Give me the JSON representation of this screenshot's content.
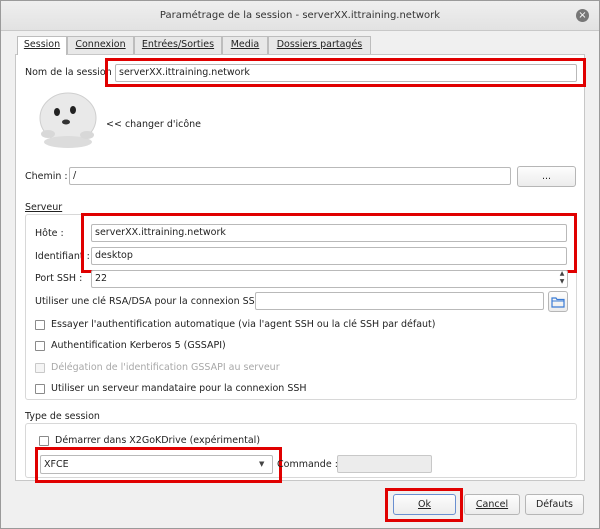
{
  "window": {
    "title": "Paramétrage de la session - serverXX.ittraining.network"
  },
  "tabs": [
    {
      "label": "Session"
    },
    {
      "label": "Connexion"
    },
    {
      "label": "Entrées/Sorties"
    },
    {
      "label": "Media"
    },
    {
      "label": "Dossiers partagés"
    }
  ],
  "session": {
    "name_label": "Nom de la session :",
    "name_value": "serverXX.ittraining.network",
    "change_icon_label": "<< changer d'icône",
    "path_label": "Chemin :",
    "path_value": "/",
    "browse_label": "..."
  },
  "server": {
    "group_label": "Serveur",
    "host_label": "Hôte :",
    "host_value": "serverXX.ittraining.network",
    "login_label": "Identifiant :",
    "login_value": "desktop",
    "port_label": "Port SSH :",
    "port_value": "22",
    "key_label": "Utiliser une clé RSA/DSA pour la connexion SSH :",
    "key_value": "",
    "auto_auth_label": "Essayer l'authentification automatique (via l'agent SSH ou la clé SSH par défaut)",
    "auto_auth_checked": false,
    "kerberos_label": "Authentification Kerberos 5 (GSSAPI)",
    "kerberos_checked": false,
    "gssapi_deleg_label": "Délégation de l'identification GSSAPI au serveur",
    "gssapi_deleg_checked": false,
    "proxy_label": "Utiliser un serveur mandataire pour la connexion SSH",
    "proxy_checked": false
  },
  "session_type": {
    "group_label": "Type de session",
    "x2gokdrive_label": "Démarrer dans X2GoKDrive (expérimental)",
    "x2gokdrive_checked": false,
    "type_value": "XFCE",
    "command_label": "Commande :",
    "command_value": ""
  },
  "footer": {
    "ok_label": "Ok",
    "cancel_label": "Cancel",
    "defaults_label": "Défauts"
  },
  "colors": {
    "highlight": "#e00000",
    "folder_icon": "#3a7bd5"
  }
}
